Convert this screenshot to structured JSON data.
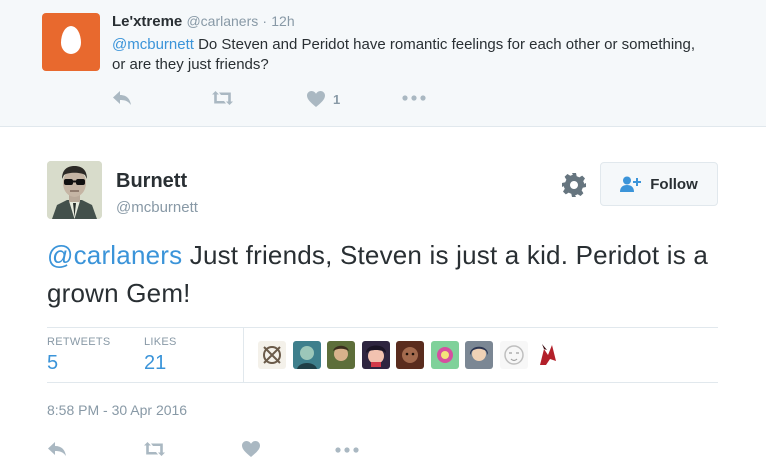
{
  "parent_tweet": {
    "name": "Le'xtreme",
    "handle": "@carlaners",
    "separator": "·",
    "time": "12h",
    "mention": "@mcburnett",
    "text": " Do Steven and Peridot have romantic feelings for each other or something, or are they just friends?",
    "like_count": "1",
    "avatar_color": "#e8692e"
  },
  "tweet": {
    "name": "Burnett",
    "handle": "@mcburnett",
    "follow_label": "Follow",
    "mention": "@carlaners",
    "text": " Just friends, Steven is just a kid. Peridot is a grown Gem!",
    "retweets_label": "RETWEETS",
    "retweets_count": "5",
    "likes_label": "LIKES",
    "likes_count": "21",
    "timestamp": "8:58 PM - 30 Apr 2016"
  },
  "icons": [
    "reply-icon",
    "retweet-icon",
    "heart-icon",
    "more-icon",
    "gear-icon",
    "follow-person-icon"
  ],
  "colors": {
    "link": "#3b94d9",
    "muted": "#8899a6",
    "action": "#aab8c2",
    "text": "#292f33"
  }
}
